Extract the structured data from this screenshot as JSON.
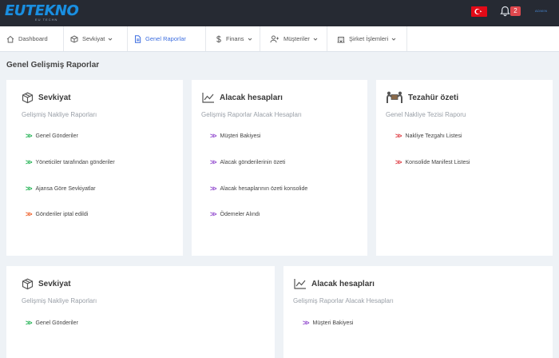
{
  "brand": {
    "name": "EUTEKNO",
    "tagline": "EU TECHN",
    "user": "ADMIN"
  },
  "header": {
    "notification_count": "2"
  },
  "nav": [
    {
      "label": "Dashboard",
      "icon": "home-icon"
    },
    {
      "label": "Sevkiyat",
      "icon": "box-icon"
    },
    {
      "label": "Genel Raporlar",
      "icon": "document-icon"
    },
    {
      "label": "Finans",
      "icon": "dollar-icon"
    },
    {
      "label": "Müşteriler",
      "icon": "add-user-icon"
    },
    {
      "label": "Şirket İşlemleri",
      "icon": "building-icon"
    }
  ],
  "page_title": "Genel Gelişmiş Raporlar",
  "cards": [
    {
      "title": "Sevkiyat",
      "subtitle": "Gelişmiş Nakliye Raporları",
      "icon": "box-icon",
      "links": [
        {
          "label": "Genel Gönderiler",
          "color": "green"
        },
        {
          "label": "Yöneticiler tarafından gönderiler",
          "color": "green"
        },
        {
          "label": "Ajansa Göre Sevkiyatlar",
          "color": "green"
        },
        {
          "label": "Gönderiler iptal edildi",
          "color": "orange"
        }
      ]
    },
    {
      "title": "Alacak hesapları",
      "subtitle": "Gelişmiş Raporlar Alacak Hesapları",
      "icon": "line-chart-icon",
      "links": [
        {
          "label": "Müşteri Bakiyesi",
          "color": "purple"
        },
        {
          "label": "Alacak gönderilerinin özeti",
          "color": "purple"
        },
        {
          "label": "Alacak hesaplarının özeti konsolide",
          "color": "purple"
        },
        {
          "label": "Ödemeler Alındı",
          "color": "purple"
        }
      ]
    },
    {
      "title": "Tezahür özeti",
      "subtitle": "Genel Nakliye Tezisi Raporu",
      "icon": "movers-icon",
      "links": [
        {
          "label": "Nakliye Tezgahı Listesi",
          "color": "red"
        },
        {
          "label": "Konsolide Manifest Listesi",
          "color": "red"
        }
      ]
    },
    {
      "title": "Sevkiyat",
      "subtitle": "Gelişmiş Nakliye Raporları",
      "icon": "box-icon",
      "links": [
        {
          "label": "Genel Gönderiler",
          "color": "green"
        }
      ]
    },
    {
      "title": "Alacak hesapları",
      "subtitle": "Gelişmiş Raporlar Alacak Hesapları",
      "icon": "line-chart-icon",
      "links": [
        {
          "label": "Müşteri Bakiyesi",
          "color": "purple"
        }
      ]
    }
  ],
  "colors": {
    "topbar": "#262a33",
    "accent": "#3d6ee0",
    "green": "#2bb55a",
    "orange": "#ef6530",
    "purple": "#9a58d2",
    "red": "#e0484e"
  }
}
